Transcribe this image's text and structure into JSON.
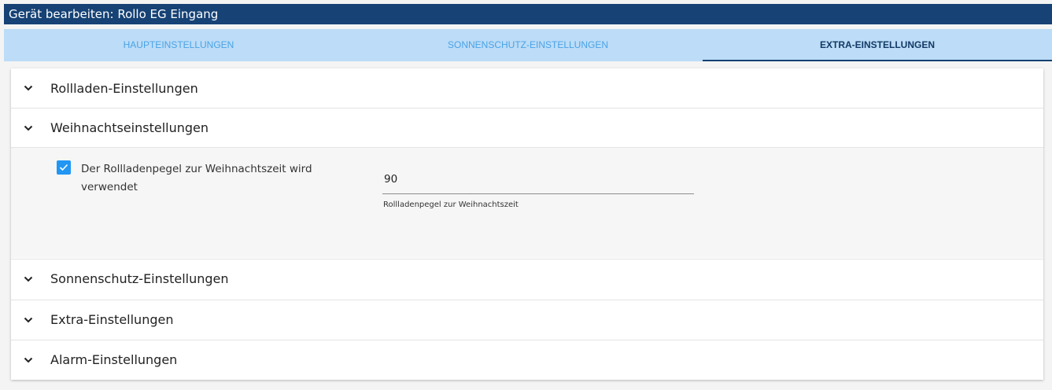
{
  "title": "Gerät bearbeiten: Rollo EG Eingang",
  "tabs": [
    {
      "label": "HAUPTEINSTELLUNGEN"
    },
    {
      "label": "SONNENSCHUTZ-EINSTELLUNGEN"
    },
    {
      "label": "EXTRA-EINSTELLUNGEN"
    }
  ],
  "active_tab": "EXTRA-EINSTELLUNGEN",
  "sections": [
    {
      "label": "Rollladen-Einstellungen"
    },
    {
      "label": "Weihnachtseinstellungen"
    },
    {
      "label": "Sonnenschutz-Einstellungen"
    },
    {
      "label": "Extra-Einstellungen"
    },
    {
      "label": "Alarm-Einstellungen"
    }
  ],
  "christmas": {
    "checkbox_label": "Der Rollladenpegel zur Weihnachtszeit wird verwendet",
    "checked": true,
    "level_value": "90",
    "level_helper": "Rollladenpegel zur Weihnachtszeit"
  },
  "colors": {
    "header_bg": "#164275",
    "tabbar_bg": "#bcdcf7",
    "tab_text": "#4aa3e6",
    "checkbox": "#2196f3"
  },
  "icons": {
    "section_toggle": "chevron-down-icon",
    "checkbox_mark": "check-icon"
  }
}
